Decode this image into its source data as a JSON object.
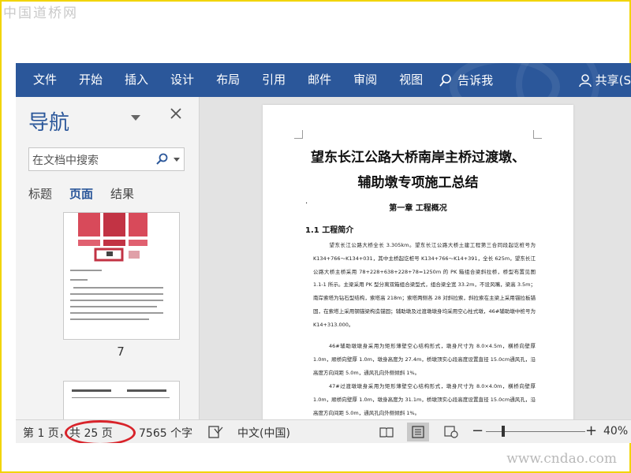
{
  "watermarks": {
    "top": "中国道桥网",
    "bottom": "www.cndao.com"
  },
  "ribbon": {
    "tabs": [
      "文件",
      "开始",
      "插入",
      "设计",
      "布局",
      "引用",
      "邮件",
      "审阅",
      "视图"
    ],
    "tell_me": "告诉我",
    "share": "共享(S"
  },
  "nav_pane": {
    "title": "导航",
    "search_placeholder": "在文档中搜索",
    "tabs": [
      "标题",
      "页面",
      "结果"
    ],
    "active_tab": "页面",
    "thumbnail_page_number": "7"
  },
  "document": {
    "title_line1": "望东长江公路大桥南岸主桥过渡墩、",
    "title_line2": "辅助墩专项施工总结",
    "chapter": "第一章 工程概况",
    "section": "1.1 工程简介",
    "paragraphs": [
      "望东长江公路大桥全长 3.305km。望东长江公路大桥土建工程第三合同段起讫桩号为 K134+766～K134+031，其中主桥起讫桩号 K134+766～K14+391，全长 625m，望东长江公路大桥主桥采用 78+228+638+228+78=1250m 的 PK 箱组合梁斜拉桥，桥型布置见图 1.1-1 所示。主梁采用 PK 型分离双箱组合梁型式，组合梁全宽 33.2m，不设风嘴，梁高 3.5m；南岸索塔为钻石型结构，索塔高 218m；索塔两侧各 28 对斜拉索，斜拉索在主梁上采用锚拉板锚固，在索塔上采用钢锚梁构造锚固；辅助墩及过渡墩墩身均采用空心柱式墩，46#辅助墩中桩号为 K14+313.000。",
      "46#辅助墩墩身采用为矩形薄壁空心结构形式，墩身尺寸为 8.0×4.5m，横桥向壁厚 1.0m，顺桥向壁厚 1.0m，墩身高度为 27.4m，桥墩顶实心段高度设置直径 15.0cm通风孔，沿高度方向间距 5.0m，通风孔向外侧倾斜 1%。",
      "47#过渡墩墩身采用为矩形薄壁空心结构形式，墩身尺寸为 8.0×4.0m，横桥向壁厚 1.0m，顺桥向壁厚 1.0m，墩身高度为 31.1m，桥墩顶实心段高度设置直径 15.0cm通风孔，沿高度方向间距 5.0m，通风孔向外侧倾斜 1%。"
    ]
  },
  "status_bar": {
    "page": "第 1 页，",
    "total_pages": "共 25 页",
    "word_count": "7565 个字",
    "language": "中文(中国)",
    "zoom": "40%"
  },
  "colors": {
    "ribbon": "#2b579a",
    "highlight_circle": "#d8232a",
    "frame": "#f2d400"
  }
}
